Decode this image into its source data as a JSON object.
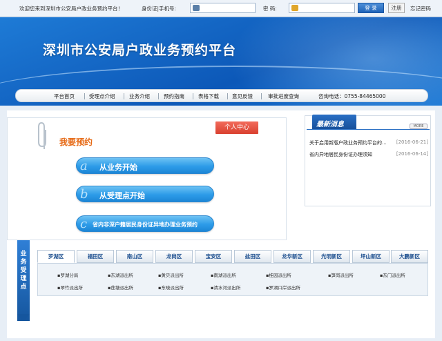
{
  "topbar": {
    "welcome": "欢迎您来到深圳市公安局户政业务预约平台！",
    "id_label": "身份证|手机号:",
    "pwd_label": "密  码:",
    "login": "登 录",
    "register": "注册",
    "forgot": "忘记密码"
  },
  "banner": {
    "title": "深圳市公安局户政业务预约平台"
  },
  "nav": {
    "items": [
      "平台首页",
      "受理点介绍",
      "业务介绍",
      "预约指南",
      "表格下载",
      "意见反馈",
      "审批进度查询"
    ],
    "hotline": "咨询电话：0755-84465000"
  },
  "booking": {
    "personal_center": "个人中心",
    "title": "我要预约",
    "btn1_letter": "a",
    "btn1": "从业务开始",
    "btn2_letter": "b",
    "btn2": "从受理点开始",
    "btn3_letter": "c",
    "btn3": "省内非深户籍居民身份证异地办理业务预约"
  },
  "news": {
    "title": "最新消息",
    "more": "MORE",
    "items": [
      {
        "text": "关于启用新版户政业务预约平台的...",
        "date": "[2016-06-21]"
      },
      {
        "text": "省内异地居民身份证办理须知",
        "date": "[2016-06-14]"
      }
    ]
  },
  "district": {
    "ribbon": "业务受理点",
    "tabs": [
      "罗湖区",
      "福田区",
      "南山区",
      "龙岗区",
      "宝安区",
      "盐田区",
      "龙华新区",
      "光明新区",
      "坪山新区",
      "大鹏新区"
    ],
    "active_tab": "罗湖区",
    "stations_row1": [
      "罗湖分局",
      "东湖派出所",
      "黄贝派出所",
      "南湖派出所",
      "桂园派出所",
      "笋岗派出所",
      "东门派出所"
    ],
    "stations_row2": [
      "翠竹派出所",
      "莲塘派出所",
      "东晓派出所",
      "清水河派出所",
      "罗湖口岸派出所"
    ]
  },
  "colors": {
    "brand_blue": "#1466c4",
    "accent_orange": "#e66a16",
    "tab_red": "#d9402f"
  }
}
